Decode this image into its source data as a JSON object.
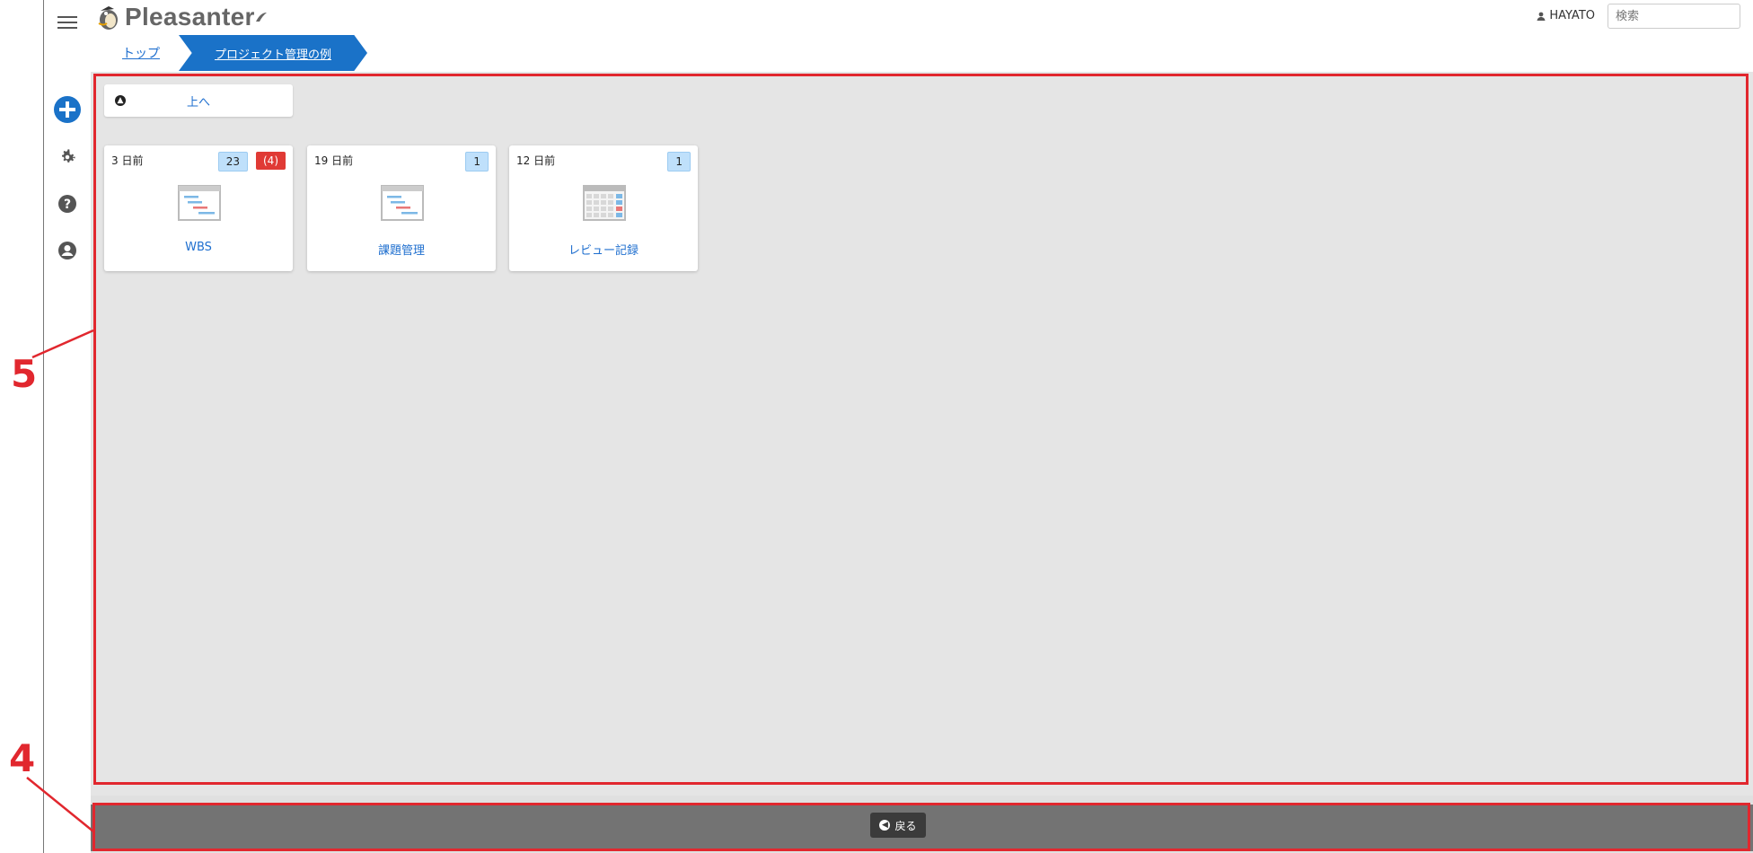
{
  "app": {
    "logo_text": "Pleasanter",
    "user_name": "HAYATO",
    "search_placeholder": "検索"
  },
  "breadcrumb": {
    "top_label": "トップ",
    "current_label": "プロジェクト管理の例"
  },
  "content": {
    "up_button_label": "上へ",
    "cards": [
      {
        "time": "3 日前",
        "badges": [
          {
            "text": "23",
            "style": "blue"
          },
          {
            "text": "(4)",
            "style": "red"
          }
        ],
        "title": "WBS",
        "icon": "gantt-icon"
      },
      {
        "time": "19 日前",
        "badges": [
          {
            "text": "1",
            "style": "blue"
          }
        ],
        "title": "課題管理",
        "icon": "gantt-icon"
      },
      {
        "time": "12 日前",
        "badges": [
          {
            "text": "1",
            "style": "blue"
          }
        ],
        "title": "レビュー記録",
        "icon": "table-icon"
      }
    ]
  },
  "footer": {
    "back_label": "戻る"
  },
  "annotations": {
    "label_5": "5",
    "label_4": "4"
  },
  "colors": {
    "accent": "#1a72c8",
    "annotation_red": "#e1272e",
    "badge_blue": "#bfe0fb",
    "badge_red": "#e03a35"
  }
}
